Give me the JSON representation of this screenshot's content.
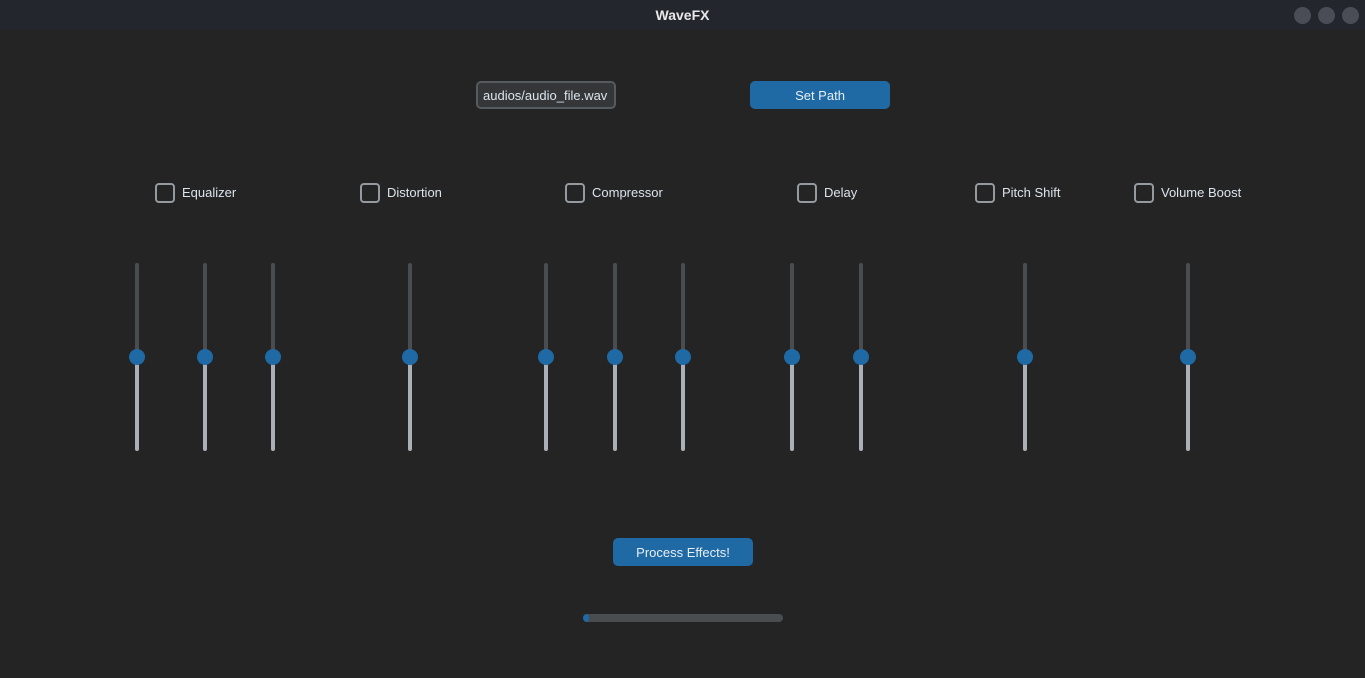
{
  "window": {
    "title": "WaveFX"
  },
  "path": {
    "value": "audios/audio_file.wav",
    "set_label": "Set Path"
  },
  "effects": [
    {
      "label": "Equalizer",
      "checked": false
    },
    {
      "label": "Distortion",
      "checked": false
    },
    {
      "label": "Compressor",
      "checked": false
    },
    {
      "label": "Delay",
      "checked": false
    },
    {
      "label": "Pitch Shift",
      "checked": false
    },
    {
      "label": "Volume Boost",
      "checked": false
    }
  ],
  "sliders": [
    {
      "group": "equalizer",
      "value": 0.5
    },
    {
      "group": "equalizer",
      "value": 0.5
    },
    {
      "group": "equalizer",
      "value": 0.5
    },
    {
      "group": "distortion",
      "value": 0.5
    },
    {
      "group": "compressor",
      "value": 0.5
    },
    {
      "group": "compressor",
      "value": 0.5
    },
    {
      "group": "compressor",
      "value": 0.5
    },
    {
      "group": "delay",
      "value": 0.5
    },
    {
      "group": "delay",
      "value": 0.5
    },
    {
      "group": "pitch-shift",
      "value": 0.5
    },
    {
      "group": "volume-boost",
      "value": 0.5
    }
  ],
  "process": {
    "label": "Process Effects!"
  },
  "progress": {
    "value": 0.03
  },
  "colors": {
    "accent": "#1f6aa5",
    "background": "#242424",
    "titlebar": "#23262d"
  }
}
